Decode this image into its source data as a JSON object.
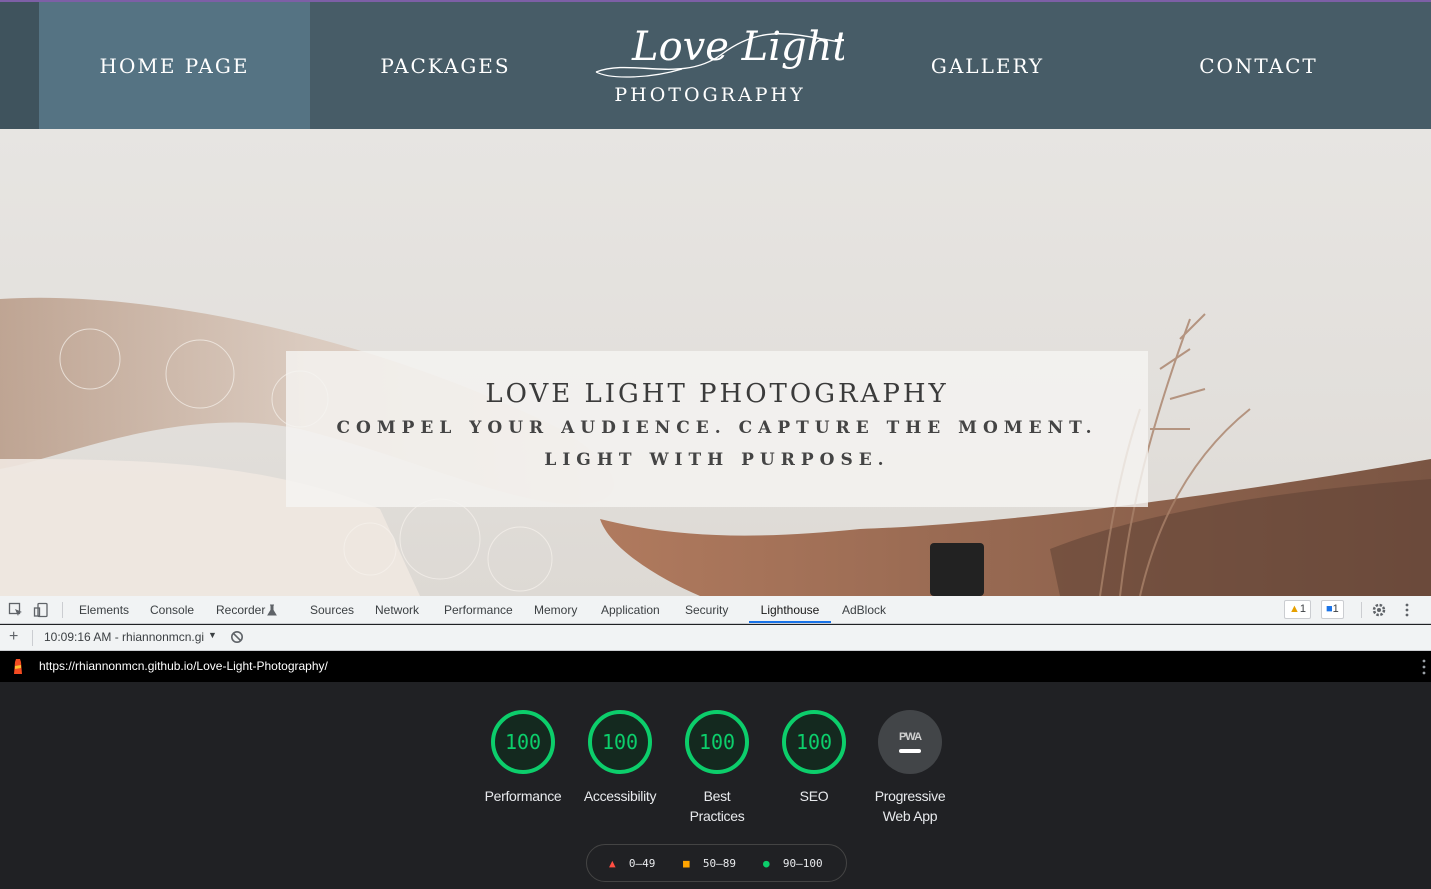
{
  "nav": {
    "items": [
      {
        "label": "HOME PAGE",
        "active": true
      },
      {
        "label": "PACKAGES",
        "active": false
      },
      {
        "label": "GALLERY",
        "active": false
      },
      {
        "label": "CONTACT",
        "active": false
      }
    ],
    "logo": {
      "script": "Love Light",
      "sub": "PHOTOGRAPHY"
    }
  },
  "hero": {
    "title": "LOVE LIGHT PHOTOGRAPHY",
    "tagline": "COMPEL YOUR AUDIENCE. CAPTURE THE MOMENT.",
    "tagline2": "LIGHT WITH PURPOSE."
  },
  "devtools": {
    "tabs": [
      "Elements",
      "Console",
      "Recorder",
      "Sources",
      "Network",
      "Performance",
      "Memory",
      "Application",
      "Security",
      "Lighthouse",
      "AdBlock"
    ],
    "selected_tab": "Lighthouse",
    "warnings_count": "1",
    "messages_count": "1",
    "report_label": "10:09:16 AM - rhiannonmcn.gi",
    "url": "https://rhiannonmcn.github.io/Love-Light-Photography/"
  },
  "lighthouse": {
    "scores": [
      {
        "label": "Performance",
        "value": "100"
      },
      {
        "label": "Accessibility",
        "value": "100"
      },
      {
        "label": "Best Practices",
        "value": "100"
      },
      {
        "label": "SEO",
        "value": "100"
      }
    ],
    "pwa": {
      "label": "Progressive Web App",
      "badge": "PWA"
    },
    "legend": [
      {
        "range": "0–49",
        "color": "#ff4e42",
        "shape": "triangle"
      },
      {
        "range": "50–89",
        "color": "#ffa400",
        "shape": "square"
      },
      {
        "range": "90–100",
        "color": "#0cce6b",
        "shape": "circle"
      }
    ]
  },
  "colors": {
    "nav_bg": "#475c67",
    "nav_active": "#557383",
    "score_good": "#0cce6b",
    "panel_bg": "#202124",
    "tab_accent": "#1a73e8"
  }
}
